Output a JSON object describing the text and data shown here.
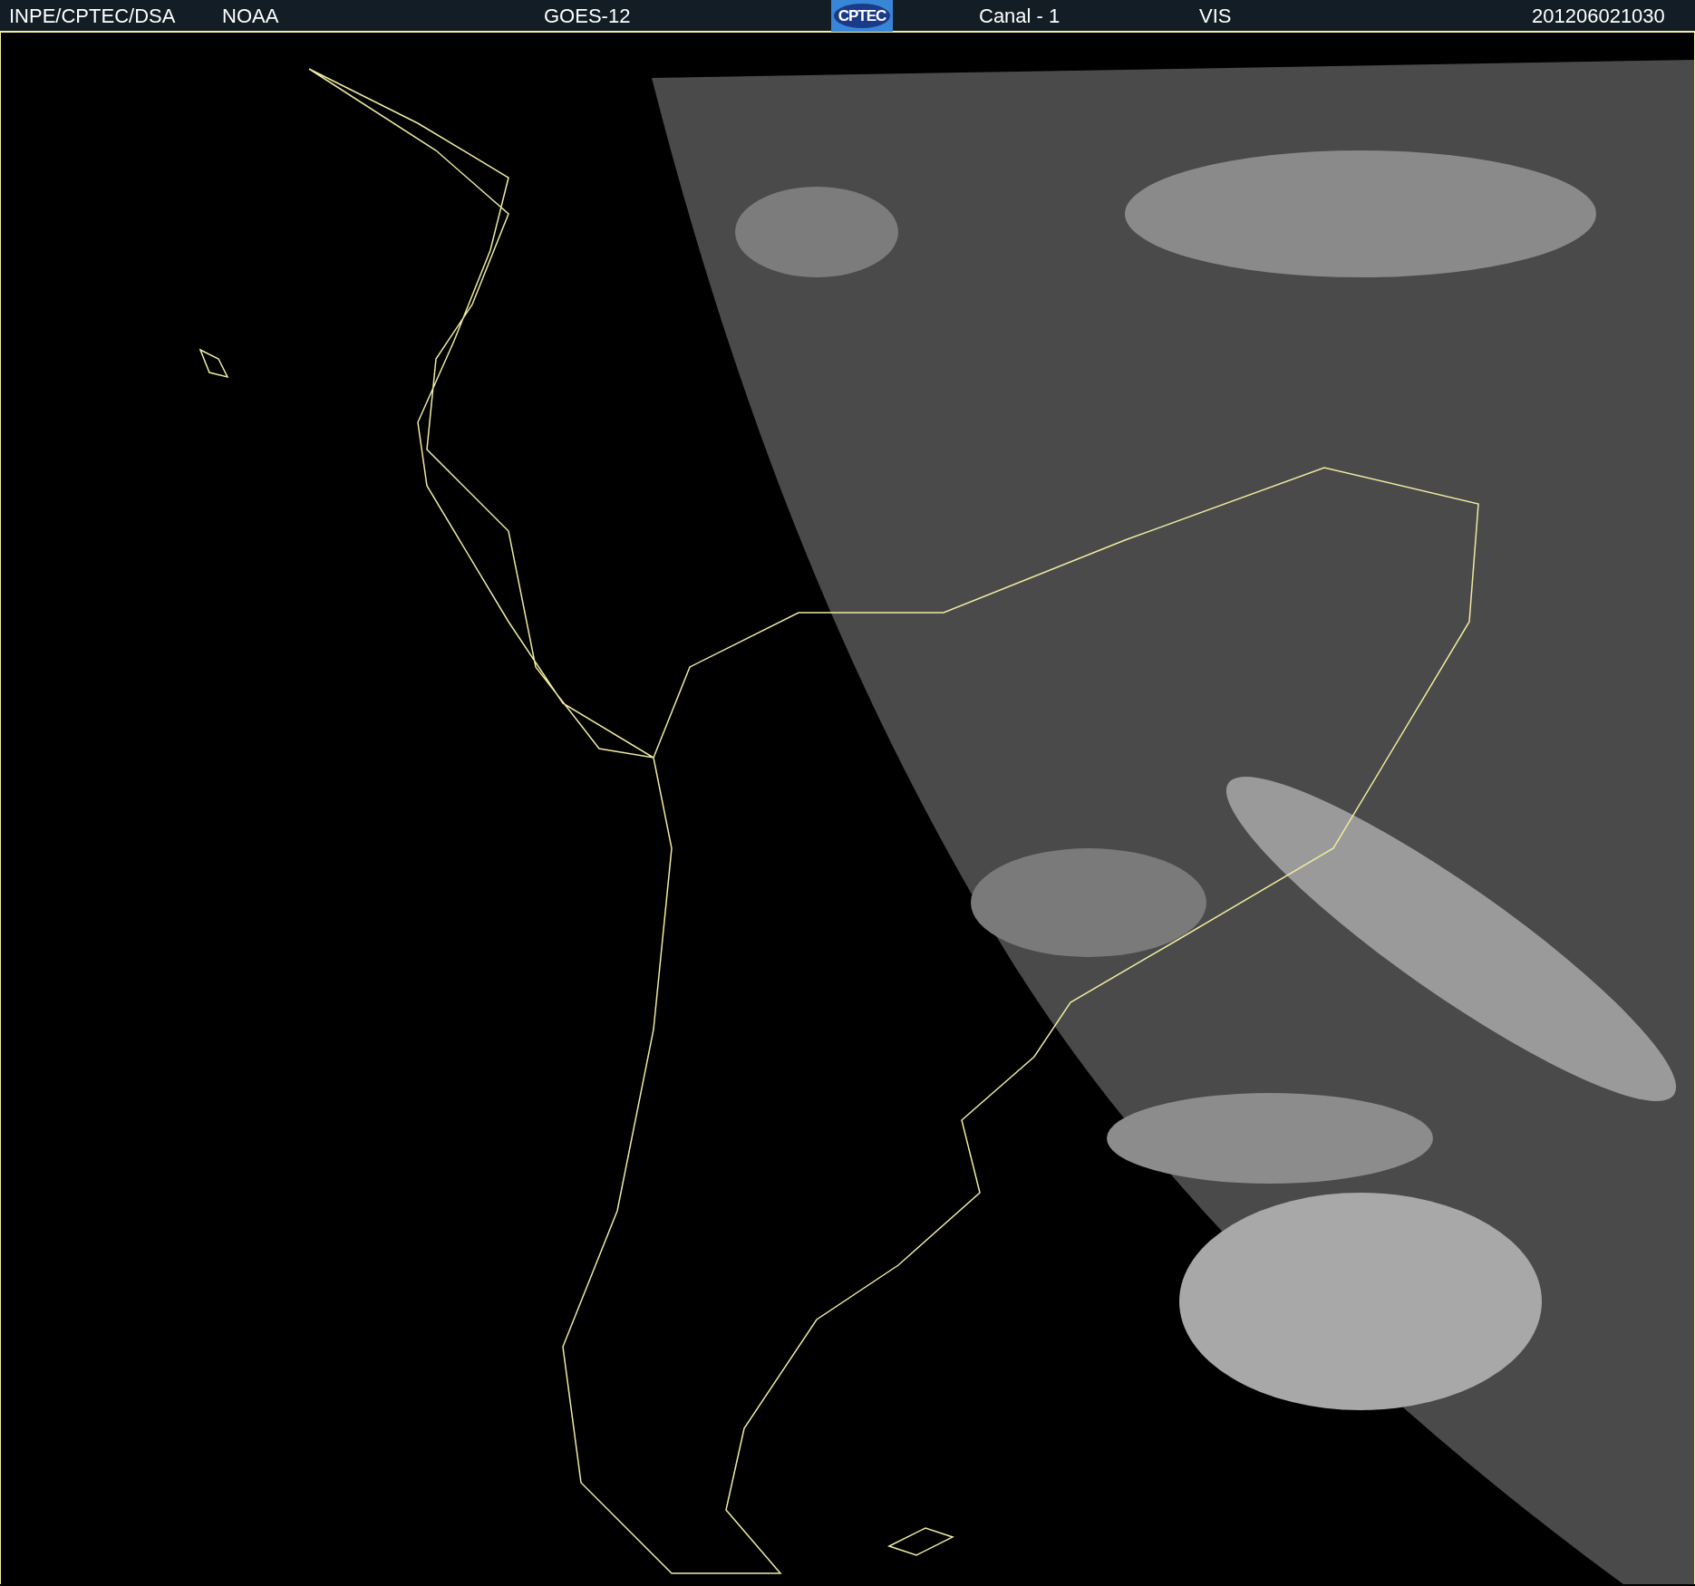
{
  "header": [
    {
      "kind": "text",
      "text": "INPE/CPTEC/DSA"
    },
    {
      "kind": "text",
      "text": "NOAA"
    },
    {
      "kind": "text",
      "text": "GOES-12"
    },
    {
      "kind": "logo",
      "text": "CPTEC"
    },
    {
      "kind": "text",
      "text": "Canal - 1"
    },
    {
      "kind": "text",
      "text": "VIS"
    },
    {
      "kind": "text",
      "text": "201206021030"
    }
  ]
}
